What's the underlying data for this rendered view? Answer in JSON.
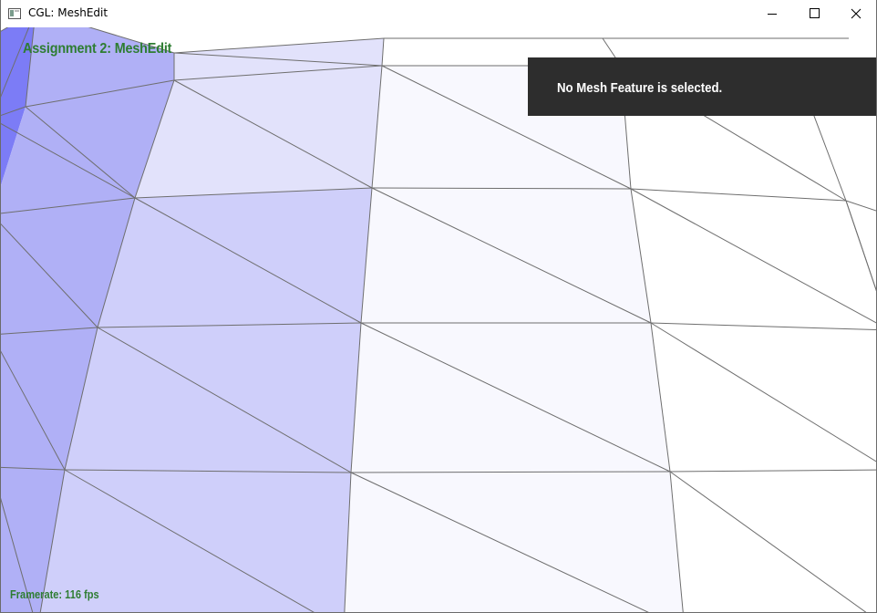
{
  "window": {
    "title": "CGL: MeshEdit",
    "app_icon": "app-window-icon",
    "controls": [
      "minimize-icon",
      "maximize-icon",
      "close-icon"
    ]
  },
  "overlay": {
    "assignment_title": "Assignment 2: MeshEdit",
    "info_message": "No Mesh Feature is selected.",
    "framerate": "Framerate: 116 fps"
  },
  "colors": {
    "overlay_text_green": "#2e7d32",
    "info_panel_bg": "#2d2d2d",
    "mesh_edge": "#6e6e6e",
    "shade_white": "#ffffff",
    "shade_lightest": "#f8f8fe",
    "shade_light": "#e2e2fb",
    "shade_mid": "#cfcffa",
    "shade_dark": "#b0b0f6",
    "shade_darkest": "#7c7cf6"
  }
}
